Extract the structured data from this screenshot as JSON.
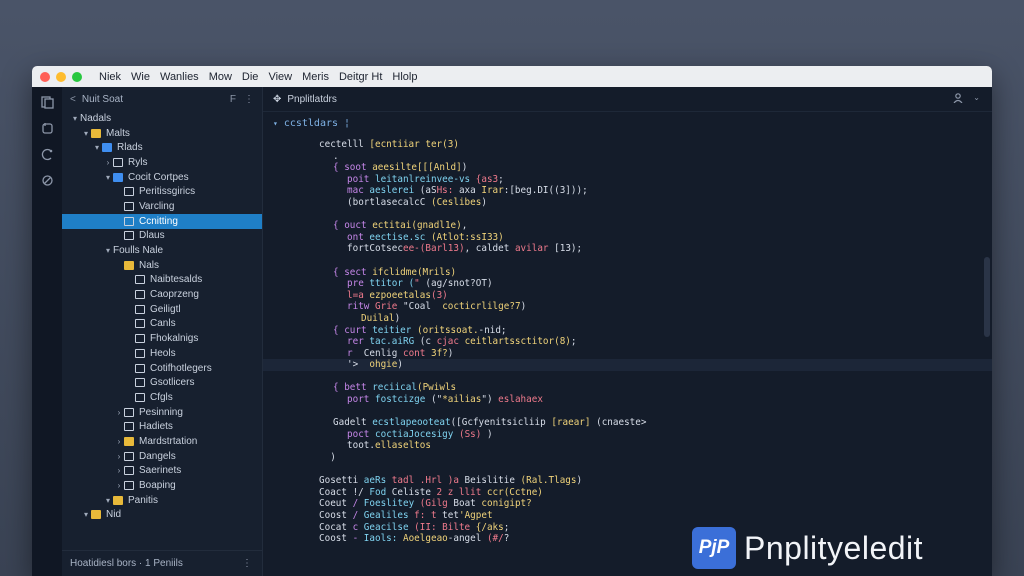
{
  "menubar": {
    "traffic_colors": [
      "#ff5f57",
      "#febc2e",
      "#28c840"
    ],
    "items": [
      "Niek",
      "Wie",
      "Wanlies",
      "Mow",
      "Die",
      "View",
      "Meris",
      "Deitgr Ht",
      "Hlolp"
    ]
  },
  "activity_bar": {
    "icons": [
      "files-icon",
      "search-icon",
      "source-control-icon",
      "extensions-icon"
    ]
  },
  "sidebar": {
    "header": "Nuit Soat",
    "header_actions": [
      "F",
      "⋮"
    ],
    "tree": [
      {
        "depth": 0,
        "caret": "▾",
        "icon": "none",
        "label": "Nadals"
      },
      {
        "depth": 1,
        "caret": "▾",
        "icon": "folder",
        "label": "Malts"
      },
      {
        "depth": 2,
        "caret": "▾",
        "icon": "blue",
        "label": "Rlads"
      },
      {
        "depth": 3,
        "caret": "›",
        "icon": "file",
        "label": "Ryls"
      },
      {
        "depth": 3,
        "caret": "▾",
        "icon": "blue",
        "label": "Cocit Cortpes"
      },
      {
        "depth": 4,
        "caret": "",
        "icon": "file",
        "label": "Peritissgirics"
      },
      {
        "depth": 4,
        "caret": "",
        "icon": "file",
        "label": "Varcling"
      },
      {
        "depth": 4,
        "caret": "",
        "icon": "file",
        "label": "Ccnitting",
        "selected": true
      },
      {
        "depth": 4,
        "caret": "",
        "icon": "file",
        "label": "Dlaus"
      },
      {
        "depth": 3,
        "caret": "▾",
        "icon": "none",
        "label": "Foulls Nale"
      },
      {
        "depth": 4,
        "caret": "",
        "icon": "folder",
        "label": "Nals"
      },
      {
        "depth": 5,
        "caret": "",
        "icon": "file",
        "label": "Naibtesalds"
      },
      {
        "depth": 5,
        "caret": "",
        "icon": "file",
        "label": "Caoprzeng"
      },
      {
        "depth": 5,
        "caret": "",
        "icon": "file",
        "label": "Geiligtl"
      },
      {
        "depth": 5,
        "caret": "",
        "icon": "file",
        "label": "Canls"
      },
      {
        "depth": 5,
        "caret": "",
        "icon": "file",
        "label": "Fhokalnigs"
      },
      {
        "depth": 5,
        "caret": "",
        "icon": "file",
        "label": "Heols"
      },
      {
        "depth": 5,
        "caret": "",
        "icon": "file",
        "label": "Cotifhotlegers"
      },
      {
        "depth": 5,
        "caret": "",
        "icon": "file",
        "label": "Gsotlicers"
      },
      {
        "depth": 5,
        "caret": "",
        "icon": "file",
        "label": "Cfgls"
      },
      {
        "depth": 4,
        "caret": "›",
        "icon": "file",
        "label": "Pesinning"
      },
      {
        "depth": 4,
        "caret": "",
        "icon": "file",
        "label": "Hadiets"
      },
      {
        "depth": 4,
        "caret": "›",
        "icon": "folder",
        "label": "Mardstrtation"
      },
      {
        "depth": 4,
        "caret": "›",
        "icon": "file",
        "label": "Dangels"
      },
      {
        "depth": 4,
        "caret": "›",
        "icon": "file",
        "label": "Saerinets"
      },
      {
        "depth": 4,
        "caret": "›",
        "icon": "file",
        "label": "Boaping"
      },
      {
        "depth": 3,
        "caret": "▾",
        "icon": "folder",
        "label": "Panitis"
      },
      {
        "depth": 1,
        "caret": "▾",
        "icon": "folder",
        "label": "Nid"
      }
    ],
    "footer": "Hoatidiesl bors · 1 Peniils"
  },
  "editor": {
    "tab_title": "Pnplitlatdrs",
    "breadcrumb": "ccstldars ¦",
    "code_lines": [
      {
        "indent": 0,
        "hl": false,
        "segs": [
          [
            "txt",
            "cectelll "
          ],
          [
            "f",
            "[ecntiiar ter(3)"
          ]
        ]
      },
      {
        "indent": 1,
        "hl": false,
        "segs": [
          [
            "txt",
            "."
          ]
        ]
      },
      {
        "indent": 1,
        "hl": false,
        "segs": [
          [
            "k",
            "{ soot "
          ],
          [
            "f",
            "aeesilte[[[Anld]"
          ],
          [
            "txt",
            ")"
          ]
        ]
      },
      {
        "indent": 2,
        "hl": false,
        "segs": [
          [
            "k",
            "poit "
          ],
          [
            "v",
            "leitanlreinvee-vs "
          ],
          [
            "s",
            "{as3"
          ],
          [
            "txt",
            ";"
          ]
        ]
      },
      {
        "indent": 2,
        "hl": false,
        "segs": [
          [
            "k",
            "mac "
          ],
          [
            "v",
            "aeslerei "
          ],
          [
            "txt",
            "(aS"
          ],
          [
            "s",
            "Hs: "
          ],
          [
            "txt",
            "axa "
          ],
          [
            "f",
            "Irar"
          ],
          [
            "txt",
            ":[beg.DI((3]));"
          ]
        ]
      },
      {
        "indent": 2,
        "hl": false,
        "segs": [
          [
            "txt",
            "(bortlasecalcC "
          ],
          [
            "f",
            "(Ceslibes"
          ],
          [
            "txt",
            ")"
          ]
        ]
      },
      {
        "indent": 1,
        "hl": false,
        "segs": [
          [
            "txt",
            ""
          ]
        ]
      },
      {
        "indent": 1,
        "hl": false,
        "segs": [
          [
            "k",
            "{ ouct "
          ],
          [
            "f",
            "ectitai(gnadl1e)"
          ],
          [
            "txt",
            ","
          ]
        ]
      },
      {
        "indent": 2,
        "hl": false,
        "segs": [
          [
            "k",
            "ont "
          ],
          [
            "v",
            "eectise.sc "
          ],
          [
            "f",
            "(Atlot:ssI33)"
          ]
        ]
      },
      {
        "indent": 2,
        "hl": false,
        "segs": [
          [
            "txt",
            "fortCotsec"
          ],
          [
            "s",
            "ee-(Barl13)"
          ],
          [
            "txt",
            ", caldet "
          ],
          [
            "s",
            "avilar"
          ],
          [
            "txt",
            " [13);"
          ]
        ]
      },
      {
        "indent": 1,
        "hl": false,
        "segs": [
          [
            "txt",
            ""
          ]
        ]
      },
      {
        "indent": 1,
        "hl": false,
        "segs": [
          [
            "k",
            "{ sect "
          ],
          [
            "f",
            "ifclidme(Mrils)"
          ]
        ]
      },
      {
        "indent": 2,
        "hl": false,
        "segs": [
          [
            "k",
            "pre "
          ],
          [
            "v",
            "ttitor ("
          ],
          [
            "s",
            "\" "
          ],
          [
            "txt",
            "(ag/snot?OT)"
          ]
        ]
      },
      {
        "indent": 2,
        "hl": false,
        "segs": [
          [
            "s",
            "l=a "
          ],
          [
            "f",
            "ezpoeetalas"
          ],
          [
            "s",
            "(3)"
          ]
        ]
      },
      {
        "indent": 2,
        "hl": false,
        "segs": [
          [
            "k",
            "ritw "
          ],
          [
            "s",
            "Grie "
          ],
          [
            "txt",
            "\"Coal  "
          ],
          [
            "f",
            "cocticrlilge?7"
          ],
          [
            "txt",
            ")"
          ]
        ]
      },
      {
        "indent": 3,
        "hl": false,
        "segs": [
          [
            "f",
            "Duilal"
          ],
          [
            "txt",
            ")"
          ]
        ]
      },
      {
        "indent": 1,
        "hl": false,
        "segs": [
          [
            "k",
            "{ curt "
          ],
          [
            "v",
            "teitier "
          ],
          [
            "f",
            "(oritssoat."
          ],
          [
            "txt",
            "-nid;"
          ]
        ]
      },
      {
        "indent": 2,
        "hl": false,
        "segs": [
          [
            "k",
            "rer "
          ],
          [
            "v",
            "tac.aiRG "
          ],
          [
            "txt",
            "(c "
          ],
          [
            "s",
            "cjac "
          ],
          [
            "f",
            "ceitlartssctitor(8)"
          ],
          [
            "txt",
            ";"
          ]
        ]
      },
      {
        "indent": 2,
        "hl": false,
        "segs": [
          [
            "k",
            "r  "
          ],
          [
            "txt",
            "Cenlig "
          ],
          [
            "s",
            "cont "
          ],
          [
            "f",
            "3f?"
          ],
          [
            "txt",
            ")"
          ]
        ]
      },
      {
        "indent": 2,
        "hl": true,
        "segs": [
          [
            "txt",
            "'>  "
          ],
          [
            "f",
            "ohgie"
          ],
          [
            "txt",
            ")"
          ]
        ]
      },
      {
        "indent": 1,
        "hl": false,
        "segs": [
          [
            "txt",
            ""
          ]
        ]
      },
      {
        "indent": 1,
        "hl": false,
        "segs": [
          [
            "k",
            "{ bett "
          ],
          [
            "v",
            "reciical"
          ],
          [
            "f",
            "(Pwiwls"
          ]
        ]
      },
      {
        "indent": 2,
        "hl": false,
        "segs": [
          [
            "k",
            "port "
          ],
          [
            "v",
            "fostcizge "
          ],
          [
            "txt",
            "(\""
          ],
          [
            "f",
            "*ailias"
          ],
          [
            "txt",
            "\") "
          ],
          [
            "s",
            "eslahaex"
          ]
        ]
      },
      {
        "indent": 1,
        "hl": false,
        "segs": [
          [
            "txt",
            ""
          ]
        ]
      },
      {
        "indent": 1,
        "hl": false,
        "segs": [
          [
            "txt",
            "Gadelt "
          ],
          [
            "v",
            "ecstlapeooteat"
          ],
          [
            "txt",
            "([Gcfyenitsicliip "
          ],
          [
            "f",
            "[raear]"
          ],
          [
            "txt",
            " (cnaeste>"
          ]
        ]
      },
      {
        "indent": 2,
        "hl": false,
        "segs": [
          [
            "k",
            "poct "
          ],
          [
            "v",
            "coctiaJocesigy "
          ],
          [
            "s",
            "(Ss)"
          ],
          [
            "txt",
            " )"
          ]
        ]
      },
      {
        "indent": 2,
        "hl": false,
        "segs": [
          [
            "txt",
            "toot."
          ],
          [
            "f",
            "ellaseltos"
          ]
        ]
      },
      {
        "indent": 0,
        "hl": false,
        "segs": [
          [
            "txt",
            "  )"
          ]
        ]
      },
      {
        "indent": 0,
        "hl": false,
        "segs": [
          [
            "txt",
            ""
          ]
        ]
      },
      {
        "indent": 0,
        "hl": false,
        "segs": [
          [
            "txt",
            "Gosetti "
          ],
          [
            "v",
            "aeRs "
          ],
          [
            "s",
            "tadl .Hrl )a "
          ],
          [
            "txt",
            "Beislitie "
          ],
          [
            "f",
            "(Ral.Tlags"
          ],
          [
            "txt",
            ")"
          ]
        ]
      },
      {
        "indent": 0,
        "hl": false,
        "segs": [
          [
            "txt",
            "Coact !/ "
          ],
          [
            "v",
            "Fod "
          ],
          [
            "txt",
            "Celiste "
          ],
          [
            "s",
            "2 z llit "
          ],
          [
            "f",
            "ccr(Cctne)"
          ]
        ]
      },
      {
        "indent": 0,
        "hl": false,
        "segs": [
          [
            "txt",
            "Coeut "
          ],
          [
            "k",
            "/ "
          ],
          [
            "v",
            "Foeslitey "
          ],
          [
            "s",
            "(Gilg "
          ],
          [
            "txt",
            "Boat "
          ],
          [
            "f",
            "conigipt?"
          ]
        ]
      },
      {
        "indent": 0,
        "hl": false,
        "segs": [
          [
            "txt",
            "Coost "
          ],
          [
            "k",
            "/ "
          ],
          [
            "v",
            "Gealiles "
          ],
          [
            "s",
            "f: t "
          ],
          [
            "txt",
            "tet"
          ],
          [
            "f",
            "'Agpet"
          ]
        ]
      },
      {
        "indent": 0,
        "hl": false,
        "segs": [
          [
            "txt",
            "Cocat "
          ],
          [
            "k",
            "c "
          ],
          [
            "v",
            "Geacilse "
          ],
          [
            "s",
            "(II: Bilte "
          ],
          [
            "f",
            "{/aks"
          ],
          [
            "txt",
            ";"
          ]
        ]
      },
      {
        "indent": 0,
        "hl": false,
        "segs": [
          [
            "txt",
            "Coost "
          ],
          [
            "k",
            "- "
          ],
          [
            "v",
            "Iaols: "
          ],
          [
            "f",
            "Aoelgeao"
          ],
          [
            "txt",
            "-angel "
          ],
          [
            "s",
            "(#/"
          ],
          [
            "txt",
            "?"
          ]
        ]
      }
    ]
  },
  "watermark": {
    "badge": "PjP",
    "text": "Pnplityeledit"
  }
}
